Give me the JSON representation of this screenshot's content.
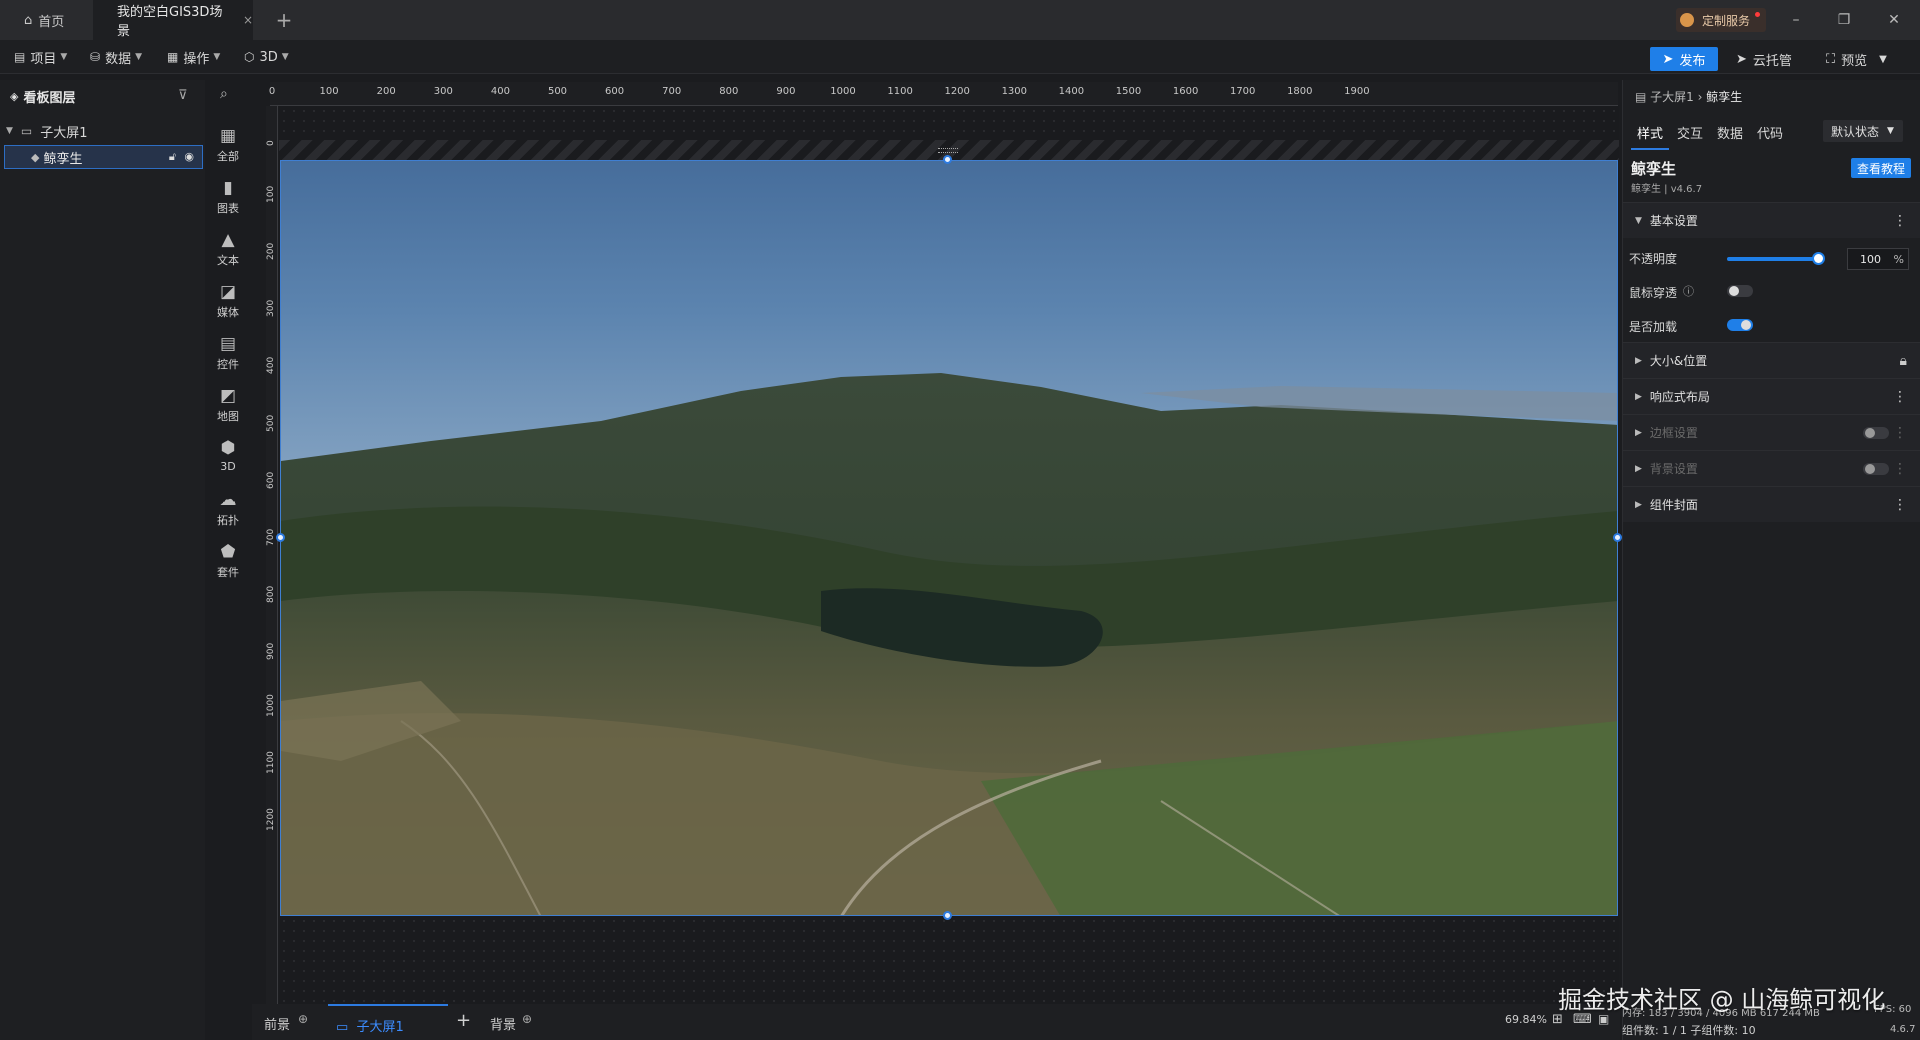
{
  "titlebar": {
    "home_tab": "首页",
    "scene_tab": "我的空白GIS3D场景",
    "close_symbol": "×",
    "add_symbol": "+",
    "custom_service": "定制服务",
    "min_symbol": "–",
    "max_symbol": "❐",
    "close_window_symbol": "✕"
  },
  "menubar": {
    "project": "项目",
    "data": "数据",
    "operate": "操作",
    "three_d": "3D",
    "publish": "发布",
    "cloud_host": "云托管",
    "preview": "预览"
  },
  "layers": {
    "title": "看板图层",
    "group_name": "子大屏1",
    "item_name": "鲸孪生"
  },
  "components": [
    {
      "label": "全部",
      "icon": "▦"
    },
    {
      "label": "图表",
      "icon": "▮"
    },
    {
      "label": "文本",
      "icon": "▲"
    },
    {
      "label": "媒体",
      "icon": "◪"
    },
    {
      "label": "控件",
      "icon": "▤"
    },
    {
      "label": "地图",
      "icon": "◩"
    },
    {
      "label": "3D",
      "icon": "⬢"
    },
    {
      "label": "拓扑",
      "icon": "☁"
    },
    {
      "label": "套件",
      "icon": "⬟"
    }
  ],
  "ruler": {
    "h_ticks": [
      "0",
      "100",
      "200",
      "300",
      "400",
      "500",
      "600",
      "700",
      "800",
      "900",
      "1000",
      "1100",
      "1200",
      "1300",
      "1400",
      "1500",
      "1600",
      "1700",
      "1800",
      "1900"
    ],
    "v_ticks": [
      "0",
      "100",
      "200",
      "300",
      "400",
      "500",
      "600",
      "700",
      "800",
      "900",
      "1000",
      "1100",
      "1200"
    ]
  },
  "bottombar": {
    "foreground": "前景",
    "sub_screen": "子大屏1",
    "background": "背景",
    "zoom": "69.84%",
    "add_symbol": "+"
  },
  "right_panel": {
    "breadcrumb_parent": "子大屏1",
    "breadcrumb_current": "鲸孪生",
    "tabs": [
      "样式",
      "交互",
      "数据",
      "代码"
    ],
    "state": "默认状态",
    "title": "鲸孪生",
    "version": "鲸孪生 | v4.6.7",
    "tutorial": "查看教程",
    "sections": {
      "basic": "基本设置",
      "size": "大小&位置",
      "responsive": "响应式布局",
      "border": "边框设置",
      "background": "背景设置",
      "cover": "组件封面"
    },
    "opacity_label": "不透明度",
    "opacity_value": "100",
    "opacity_unit": "%",
    "opacity_level": 1.0,
    "mouse_through_label": "鼠标穿透",
    "mouse_through_on": false,
    "load_label": "是否加载",
    "load_on": true
  },
  "status": {
    "line1": "内存: 183 / 3904 / 4096 MB  617 244 MB",
    "line2": "组件数: 1 / 1   子组件数: 10",
    "fps": "FPS: 60",
    "build": "4.6.7"
  },
  "watermark": "掘金技术社区 @ 山海鲸可视化",
  "colors": {
    "accent": "#1f7fe8",
    "panel": "#1e1f22",
    "canvas": "#1a1b1e"
  }
}
